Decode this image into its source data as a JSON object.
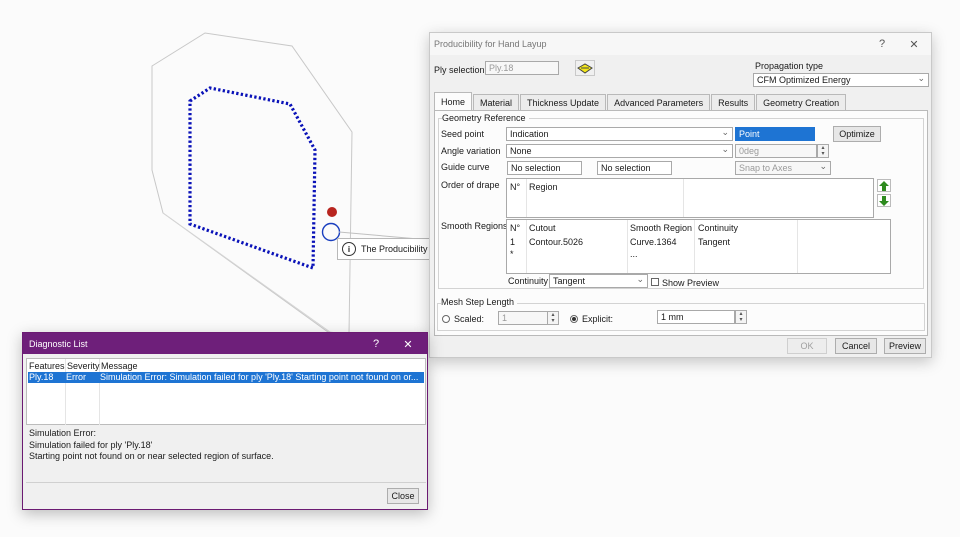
{
  "viewport": {
    "callout_text": "The Producibility"
  },
  "hand_layup": {
    "title": "Producibility for Hand Layup",
    "help": "?",
    "close": "✕",
    "ply_selection_label": "Ply selection",
    "ply_selection_value": "Ply.18",
    "propagation_type_label": "Propagation type",
    "propagation_type_value": "CFM Optimized Energy",
    "tabs": [
      "Home",
      "Material",
      "Thickness Update",
      "Advanced Parameters",
      "Results",
      "Geometry Creation"
    ],
    "geometry_reference": {
      "group": "Geometry Reference",
      "seed_point_label": "Seed point",
      "seed_point_value": "Indication",
      "point_value": "Point",
      "optimize": "Optimize",
      "angle_variation_label": "Angle variation",
      "angle_variation_value": "None",
      "angle_value": "0deg",
      "guide_curve_label": "Guide curve",
      "guide_curve_1": "No selection",
      "guide_curve_2": "No selection",
      "snap_to_axes": "Snap to Axes",
      "order_of_drape_label": "Order of drape",
      "drape_headers": [
        "N°",
        "Region"
      ],
      "smooth_regions_label": "Smooth Regions",
      "smooth_headers": [
        "N°",
        "Cutout",
        "Smooth Region",
        "Continuity"
      ],
      "smooth_rows": [
        [
          "1",
          "Contour.5026",
          "Curve.1364",
          "Tangent"
        ],
        [
          "*",
          "",
          "...",
          ""
        ]
      ],
      "continuity_label": "Continuity",
      "continuity_value": "Tangent",
      "show_preview": "Show Preview"
    },
    "mesh_step": {
      "group": "Mesh Step Length",
      "scaled_label": "Scaled:",
      "scaled_value": "1",
      "explicit_label": "Explicit:",
      "explicit_value": "1 mm"
    },
    "buttons": {
      "ok": "OK",
      "cancel": "Cancel",
      "preview": "Preview"
    }
  },
  "diagnostic": {
    "title": "Diagnostic List",
    "help": "?",
    "close": "✕",
    "headers": [
      "Features",
      "Severity",
      "Message"
    ],
    "row": {
      "feature": "Ply.18",
      "severity": "Error",
      "message": "Simulation Error:   Simulation failed for ply 'Ply.18'   Starting point not found on or..."
    },
    "detail": [
      "Simulation Error:",
      "Simulation failed for ply 'Ply.18'",
      "Starting point not found on or near selected region of surface."
    ],
    "close_button": "Close"
  },
  "colors": {
    "diagnostic_title_bg": "#6e1f7a",
    "selection_blue": "#1e74d3",
    "dotted_path": "#0a12b8",
    "seed_marker": "#b8251f"
  }
}
